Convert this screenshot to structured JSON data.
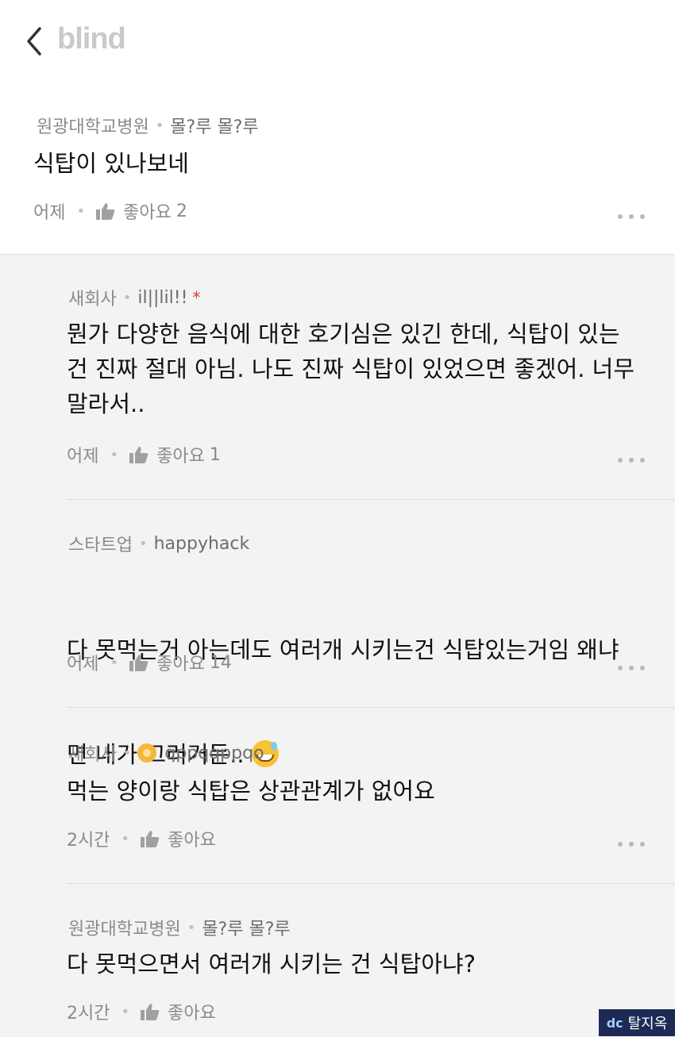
{
  "header": {
    "logo": "blind"
  },
  "comments": [
    {
      "company": "원광대학교병원",
      "nickname": "몰?루 몰?루",
      "text": "식탑이 있나보네",
      "time": "어제",
      "like_label": "좋아요",
      "like_count": "2"
    },
    {
      "company": "새회사",
      "nickname": "il||lil!!",
      "text": "뭔가 다양한 음식에 대한 호기심은 있긴 한데, 식탑이 있는\n건 진짜 절대 아님. 나도 진짜 식탑이 있었으면 좋겠어. 너무\n말라서..",
      "time": "어제",
      "like_label": "좋아요",
      "like_count": "1"
    },
    {
      "company": "스타트업",
      "nickname": "happyhack",
      "text_line1": "다 못먹는거 아는데도 여러개 시키는건 식탑있는거임 왜냐",
      "text_line2": "면 내가 그러거든.. ",
      "time": "어제",
      "like_label": "좋아요",
      "like_count": "14"
    },
    {
      "company": "새회사",
      "nickname": "qppqqppqo",
      "text": "먹는 양이랑 식탑은 상관관계가 없어요",
      "time": "2시간",
      "like_label": "좋아요"
    },
    {
      "company": "원광대학교병원",
      "nickname": "몰?루 몰?루",
      "text": "다 못먹으면서 여러개 시키는 건 식탑아냐?",
      "time": "2시간",
      "like_label": "좋아요"
    }
  ],
  "watermark": {
    "mark": "dc",
    "text": "탈지옥"
  }
}
